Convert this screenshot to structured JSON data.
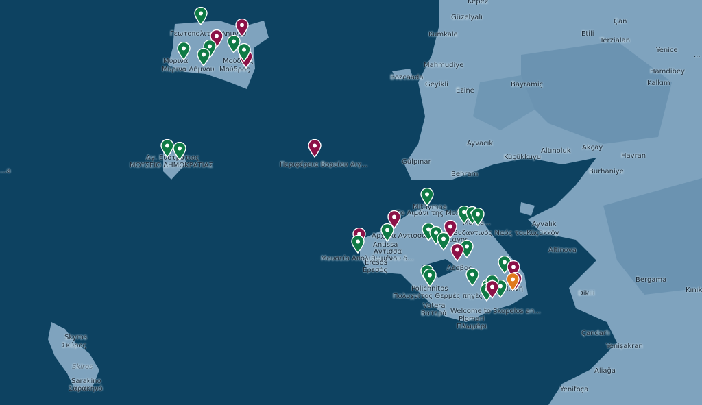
{
  "colors": {
    "sea": "#0d4261",
    "land": "#7fa3be",
    "land_dark": "#5e87a6",
    "green_pin": "#0f7a45",
    "purple_pin": "#8c1147",
    "orange_pin": "#e07a1c"
  },
  "labels": {
    "kepez": "Kepez",
    "guzelyali": "Güzelyalı",
    "kumkale": "Kumkale",
    "etili": "Etili",
    "can": "Çan",
    "terzialan": "Terzialan",
    "yenice": "Yenice",
    "mahmudiye": "Mahmudiye",
    "bozcaada": "Bozcaada",
    "geyikli": "Geyikli",
    "ezine": "Ezine",
    "bayramic": "Bayramiç",
    "hamdibey": "Hamdibey",
    "kalkim": "Kalkım",
    "ayvacik": "Ayvacık",
    "altinoluk": "Altınoluk",
    "akcay": "Akçay",
    "havran": "Havran",
    "gulpinar": "Gülpınar",
    "kucukkuyu": "Küçükkuyu",
    "burhaniye": "Burhaniye",
    "behram": "Behram",
    "ayvalik": "Ayvalık",
    "kucukkoy": "Küçükköy",
    "altinova": "Altinova",
    "bergama": "Bergama",
    "kinik": "Kınık",
    "dikili": "Dikili",
    "candarli": "Çandarlı",
    "yenisakran": "Yenişakran",
    "aliaga": "Aliağa",
    "yenifoca": "Yenifoça",
    "limnos_museum": "Γεωτοπολιτης Λημνου",
    "myrina": "Μύρινα",
    "myrina2": "Μύρινα Λήμνου",
    "moudros": "Μούδρος",
    "moudros2": "Μούδρος",
    "ai_efstratios": "Αγ. Ευστράτιος",
    "museum_demo": "ΜΟΥΣΕΙΟ ΔΗΜΟΚΡΑΤΙΑΣ",
    "perifereia": "Περιφέρεια Βορείου Αιγ...",
    "mithymna": "Mithymna",
    "to_ligkato": "Το Λιμάνι της Μολύβου",
    "antissa1": "Αρχαία Αντισσα",
    "antissa": "Antissa",
    "antissa2": "Αντισσα",
    "museum_apoli": "Μουσείο Απολιθωμένου δ...",
    "eresos": "Eresos",
    "eresos2": "Ερεσός",
    "mantamados": "Manta...",
    "byz": "Ο Βυζαντινός Ναός του ...",
    "agiasos": "...αγος",
    "lesvos": "Λέσβος",
    "polichnitos": "Polichnitos",
    "polichnitos2": "Πολυχνίτος Θερμές πηγές",
    "vatera": "Vatera",
    "vatera2": "Βατερά",
    "welcome": "Welcome to Skopelos an...",
    "plomari": "Plomari",
    "plomari2": "Πλωμάρι",
    "mytilini": "Μ...νη",
    "skyros": "Skyros",
    "skyros2": "Σκύρος",
    "skiros": "Skiros",
    "sarakino": "Sarakino",
    "sarakino2": "Σαρακηνό",
    "edge1": "...a",
    "edge2": "..."
  },
  "pins": [
    {
      "c": "green"
    },
    {
      "c": "purple"
    },
    {
      "c": "purple"
    },
    {
      "c": "green"
    },
    {
      "c": "green"
    },
    {
      "c": "green"
    },
    {
      "c": "green"
    },
    {
      "c": "purple"
    },
    {
      "c": "green"
    },
    {
      "c": "green"
    },
    {
      "c": "green"
    },
    {
      "c": "purple"
    },
    {
      "c": "green"
    },
    {
      "c": "purple"
    },
    {
      "c": "purple"
    },
    {
      "c": "green"
    },
    {
      "c": "green"
    },
    {
      "c": "green"
    },
    {
      "c": "green"
    },
    {
      "c": "green"
    },
    {
      "c": "green"
    },
    {
      "c": "green"
    },
    {
      "c": "green"
    },
    {
      "c": "green"
    },
    {
      "c": "purple"
    },
    {
      "c": "purple"
    },
    {
      "c": "green"
    },
    {
      "c": "green"
    },
    {
      "c": "green"
    },
    {
      "c": "green"
    },
    {
      "c": "green"
    },
    {
      "c": "green"
    },
    {
      "c": "purple"
    },
    {
      "c": "purple"
    },
    {
      "c": "green"
    },
    {
      "c": "green"
    },
    {
      "c": "purple"
    },
    {
      "c": "orange"
    }
  ]
}
